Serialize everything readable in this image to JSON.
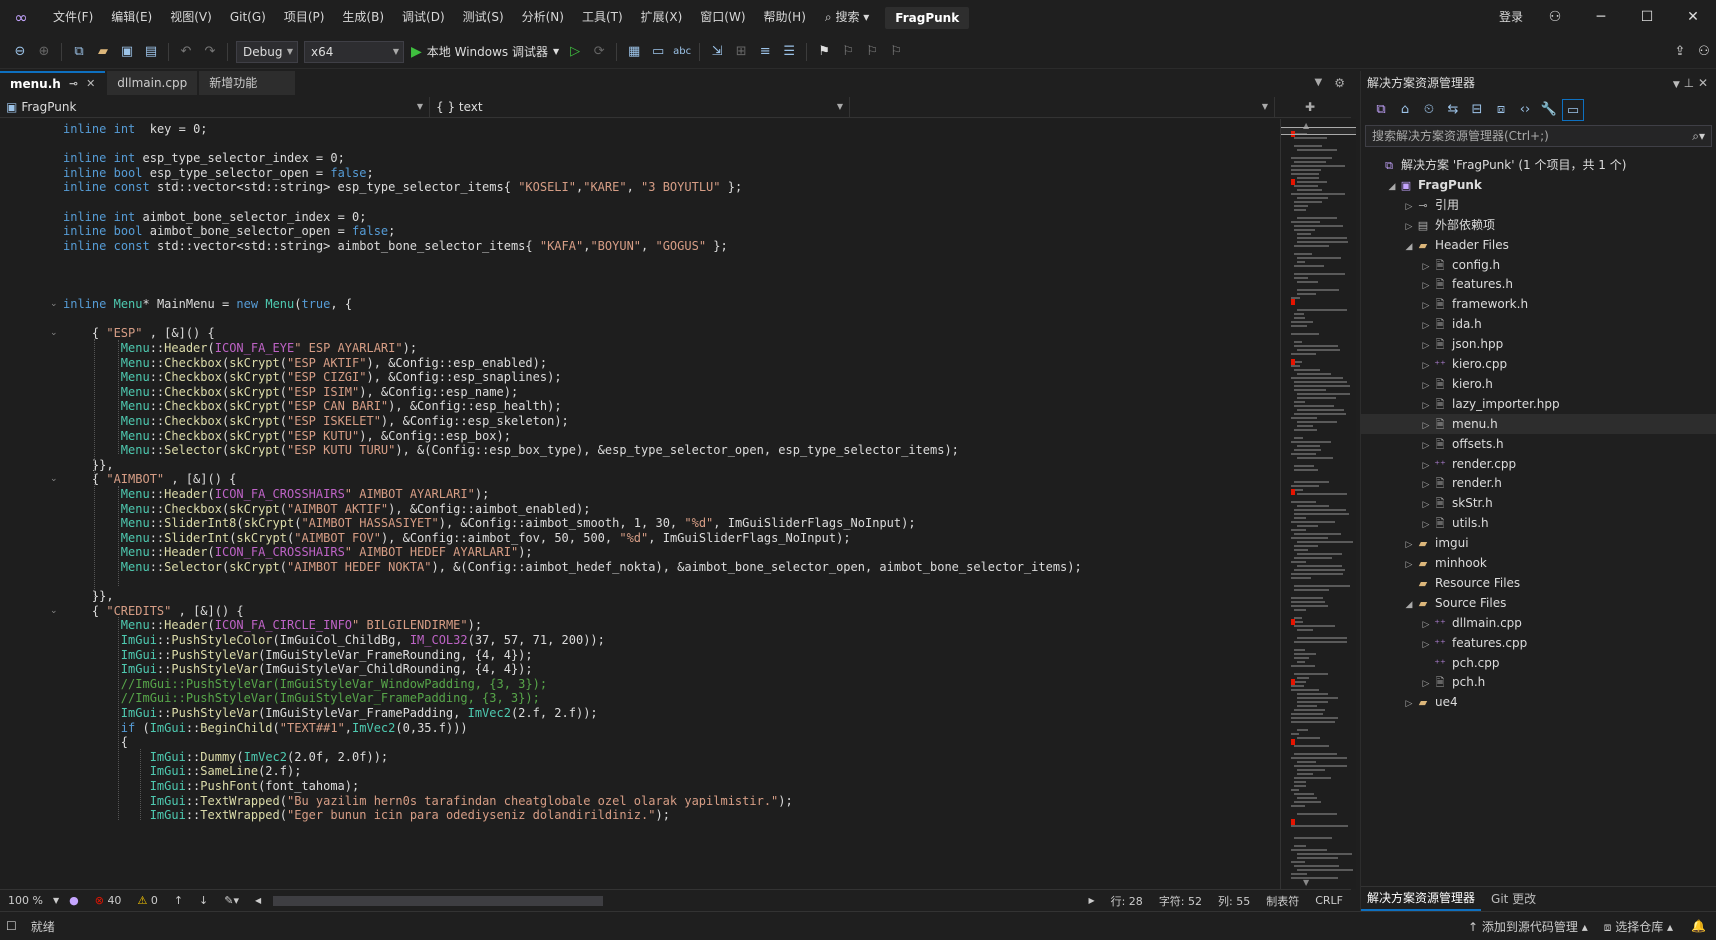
{
  "menu": {
    "items": [
      "文件(F)",
      "编辑(E)",
      "视图(V)",
      "Git(G)",
      "项目(P)",
      "生成(B)",
      "调试(D)",
      "测试(S)",
      "分析(N)",
      "工具(T)",
      "扩展(X)",
      "窗口(W)",
      "帮助(H)"
    ],
    "search": "搜索",
    "solution": "FragPunk",
    "login": "登录"
  },
  "toolbar": {
    "config": "Debug",
    "platform": "x64",
    "debugger": "本地 Windows 调试器"
  },
  "tabs": [
    {
      "label": "menu.h",
      "active": true
    },
    {
      "label": "dllmain.cpp"
    },
    {
      "label": "新增功能"
    }
  ],
  "nav": {
    "project": "FragPunk",
    "scope": "{ } text"
  },
  "status": {
    "zoom": "100 %",
    "errors": "40",
    "warnings": "0",
    "line": "行: 28",
    "char": "字符: 52",
    "col": "列: 55",
    "tabs": "制表符",
    "eol": "CRLF",
    "ready": "就绪",
    "addsrc": "添加到源代码管理",
    "selrepo": "选择仓库"
  },
  "solution_explorer": {
    "title": "解决方案资源管理器",
    "search": "搜索解决方案资源管理器(Ctrl+;)",
    "tab_active": "解决方案资源管理器",
    "tab_git": "Git 更改"
  },
  "tree": [
    {
      "text": "解决方案 'FragPunk' (1 个项目，共 1 个)",
      "lvl": 0,
      "icon": "solution",
      "tw": ""
    },
    {
      "text": "FragPunk",
      "lvl": 1,
      "icon": "project",
      "tw": "◢",
      "bold": true
    },
    {
      "text": "引用",
      "lvl": 2,
      "icon": "ref",
      "tw": "▷"
    },
    {
      "text": "外部依赖项",
      "lvl": 2,
      "icon": "ext",
      "tw": "▷"
    },
    {
      "text": "Header Files",
      "lvl": 2,
      "icon": "folder",
      "tw": "◢"
    },
    {
      "text": "config.h",
      "lvl": 3,
      "icon": "h",
      "tw": "▷"
    },
    {
      "text": "features.h",
      "lvl": 3,
      "icon": "h",
      "tw": "▷"
    },
    {
      "text": "framework.h",
      "lvl": 3,
      "icon": "h",
      "tw": "▷"
    },
    {
      "text": "ida.h",
      "lvl": 3,
      "icon": "h",
      "tw": "▷"
    },
    {
      "text": "json.hpp",
      "lvl": 3,
      "icon": "h",
      "tw": "▷"
    },
    {
      "text": "kiero.cpp",
      "lvl": 3,
      "icon": "cpp",
      "tw": "▷"
    },
    {
      "text": "kiero.h",
      "lvl": 3,
      "icon": "h",
      "tw": "▷"
    },
    {
      "text": "lazy_importer.hpp",
      "lvl": 3,
      "icon": "h",
      "tw": "▷"
    },
    {
      "text": "menu.h",
      "lvl": 3,
      "icon": "h",
      "tw": "▷",
      "sel": true
    },
    {
      "text": "offsets.h",
      "lvl": 3,
      "icon": "h",
      "tw": "▷"
    },
    {
      "text": "render.cpp",
      "lvl": 3,
      "icon": "cpp",
      "tw": "▷"
    },
    {
      "text": "render.h",
      "lvl": 3,
      "icon": "h",
      "tw": "▷"
    },
    {
      "text": "skStr.h",
      "lvl": 3,
      "icon": "h",
      "tw": "▷"
    },
    {
      "text": "utils.h",
      "lvl": 3,
      "icon": "h",
      "tw": "▷"
    },
    {
      "text": "imgui",
      "lvl": 2,
      "icon": "folder",
      "tw": "▷"
    },
    {
      "text": "minhook",
      "lvl": 2,
      "icon": "folder",
      "tw": "▷"
    },
    {
      "text": "Resource Files",
      "lvl": 2,
      "icon": "folder",
      "tw": ""
    },
    {
      "text": "Source Files",
      "lvl": 2,
      "icon": "folder",
      "tw": "◢"
    },
    {
      "text": "dllmain.cpp",
      "lvl": 3,
      "icon": "cpp",
      "tw": "▷"
    },
    {
      "text": "features.cpp",
      "lvl": 3,
      "icon": "cpp",
      "tw": "▷"
    },
    {
      "text": "pch.cpp",
      "lvl": 3,
      "icon": "cpp",
      "tw": ""
    },
    {
      "text": "pch.h",
      "lvl": 3,
      "icon": "h",
      "tw": "▷"
    },
    {
      "text": "ue4",
      "lvl": 2,
      "icon": "folder",
      "tw": "▷"
    }
  ],
  "code": [
    "inline int  key = 0;",
    "",
    "inline int esp_type_selector_index = 0;",
    "inline bool esp_type_selector_open = false;",
    "inline const std::vector<std::string> esp_type_selector_items{ \"KOSELI\",\"KARE\", \"3 BOYUTLU\" };",
    "",
    "inline int aimbot_bone_selector_index = 0;",
    "inline bool aimbot_bone_selector_open = false;",
    "inline const std::vector<std::string> aimbot_bone_selector_items{ \"KAFA\",\"BOYUN\", \"GOGUS\" };",
    "",
    "",
    "",
    "inline Menu* MainMenu = new Menu(true, {",
    "",
    "    { \"ESP\" , [&]() {",
    "        Menu::Header(ICON_FA_EYE\" ESP AYARLARI\");",
    "        Menu::Checkbox(skCrypt(\"ESP AKTIF\"), &Config::esp_enabled);",
    "        Menu::Checkbox(skCrypt(\"ESP CIZGI\"), &Config::esp_snaplines);",
    "        Menu::Checkbox(skCrypt(\"ESP ISIM\"), &Config::esp_name);",
    "        Menu::Checkbox(skCrypt(\"ESP CAN BARI\"), &Config::esp_health);",
    "        Menu::Checkbox(skCrypt(\"ESP ISKELET\"), &Config::esp_skeleton);",
    "        Menu::Checkbox(skCrypt(\"ESP KUTU\"), &Config::esp_box);",
    "        Menu::Selector(skCrypt(\"ESP KUTU TURU\"), &(Config::esp_box_type), &esp_type_selector_open, esp_type_selector_items);",
    "    }},",
    "    { \"AIMBOT\" , [&]() {",
    "        Menu::Header(ICON_FA_CROSSHAIRS\" AIMBOT AYARLARI\");",
    "        Menu::Checkbox(skCrypt(\"AIMBOT AKTIF\"), &Config::aimbot_enabled);",
    "        Menu::SliderInt8(skCrypt(\"AIMBOT HASSASIYET\"), &Config::aimbot_smooth, 1, 30, \"%d\", ImGuiSliderFlags_NoInput);",
    "        Menu::SliderInt(skCrypt(\"AIMBOT FOV\"), &Config::aimbot_fov, 50, 500, \"%d\", ImGuiSliderFlags_NoInput);",
    "        Menu::Header(ICON_FA_CROSSHAIRS\" AIMBOT HEDEF AYARLARI\");",
    "        Menu::Selector(skCrypt(\"AIMBOT HEDEF NOKTA\"), &(Config::aimbot_hedef_nokta), &aimbot_bone_selector_open, aimbot_bone_selector_items);",
    "",
    "    }},",
    "    { \"CREDITS\" , [&]() {",
    "        Menu::Header(ICON_FA_CIRCLE_INFO\" BILGILENDIRME\");",
    "        ImGui::PushStyleColor(ImGuiCol_ChildBg, IM_COL32(37, 57, 71, 200));",
    "        ImGui::PushStyleVar(ImGuiStyleVar_FrameRounding, {4, 4});",
    "        ImGui::PushStyleVar(ImGuiStyleVar_ChildRounding, {4, 4});",
    "        //ImGui::PushStyleVar(ImGuiStyleVar_WindowPadding, {3, 3});",
    "        //ImGui::PushStyleVar(ImGuiStyleVar_FramePadding, {3, 3});",
    "        ImGui::PushStyleVar(ImGuiStyleVar_FramePadding, ImVec2(2.f, 2.f));",
    "        if (ImGui::BeginChild(\"TEXT##1\",ImVec2(0,35.f)))",
    "        {",
    "            ImGui::Dummy(ImVec2(2.0f, 2.0f));",
    "            ImGui::SameLine(2.f);",
    "            ImGui::PushFont(font_tahoma);",
    "            ImGui::TextWrapped(\"Bu yazilim hern0s tarafindan cheatglobale ozel olarak yapilmistir.\");",
    "            ImGui::TextWrapped(\"Eger bunun icin para odediyseniz dolandirildiniz.\");"
  ],
  "colors": {
    "accent": "#0e70c0",
    "keyword": "#569cd6",
    "string": "#d69d85",
    "type": "#4ec9b0",
    "comment": "#57a64a",
    "error": "#e51400"
  }
}
